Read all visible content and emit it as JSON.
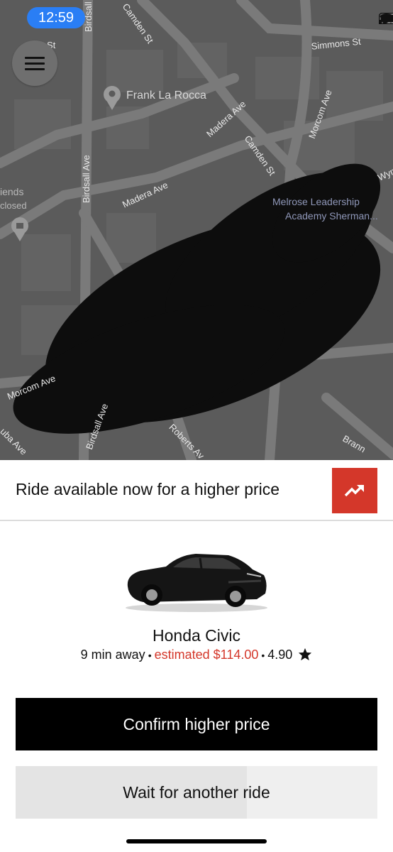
{
  "status_bar": {
    "time": "12:59",
    "icons": [
      "signal-icon",
      "wifi-icon",
      "battery-icon"
    ]
  },
  "map": {
    "streets": {
      "s1": "St",
      "s2": "Birdsall",
      "s3": "Camden St",
      "s4": "Simmons St",
      "s5": "Madera Ave",
      "s6": "Morcom Ave",
      "s7": "Camden St",
      "s8": "Birdsall Ave",
      "s9": "Madera Ave",
      "s10": "Morcom Ave",
      "s11": "Birdsall Ave",
      "s12": "Roberts Av",
      "s13": "uba Ave",
      "s14": "Brann",
      "s15": "Wym"
    },
    "pois": {
      "frank": "Frank La Rocca",
      "friends": "iends",
      "closed": "closed",
      "melrose1": "Melrose Leadership",
      "melrose2": "Academy Sherman..."
    }
  },
  "surge_banner": {
    "text": "Ride available now for a higher price",
    "icon": "trending-up-icon",
    "accent_color": "#d4372a"
  },
  "ride": {
    "car_name": "Honda Civic",
    "eta": "9 min away",
    "price": "estimated $114.00",
    "rating": "4.90",
    "rating_icon": "star-icon"
  },
  "actions": {
    "confirm_label": "Confirm higher price",
    "wait_label": "Wait for another ride",
    "wait_progress_fraction": 0.64
  }
}
